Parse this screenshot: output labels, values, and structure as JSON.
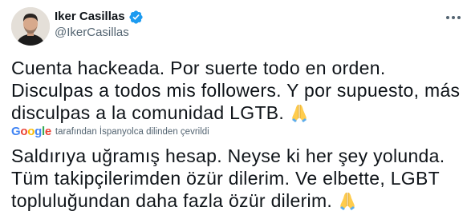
{
  "author": {
    "display_name": "Iker Casillas",
    "handle": "@IkerCasillas",
    "verified": true
  },
  "tweet": {
    "text": "Cuenta hackeada. Por suerte todo en orden. Disculpas a todos mis followers. Y por supuesto, más disculpas a la comunidad LGTB.",
    "emoji": "folded-hands"
  },
  "translation": {
    "provider_letters": [
      "G",
      "o",
      "o",
      "g",
      "l",
      "e"
    ],
    "caption": "tarafından İspanyolca dilinden çevrildi",
    "text": "Saldırıya uğramış hesap. Neyse ki her şey yolunda. Tüm takipçilerimden özür dilerim. Ve elbette, LGBT topluluğundan daha fazla özür dilerim."
  },
  "colors": {
    "verified_badge": "#1d9bf0",
    "secondary_text": "#536471",
    "primary_text": "#0f1419"
  },
  "icons": {
    "more": "more-dots-icon",
    "verified": "verified-badge-icon",
    "emoji": "folded-hands-emoji"
  }
}
